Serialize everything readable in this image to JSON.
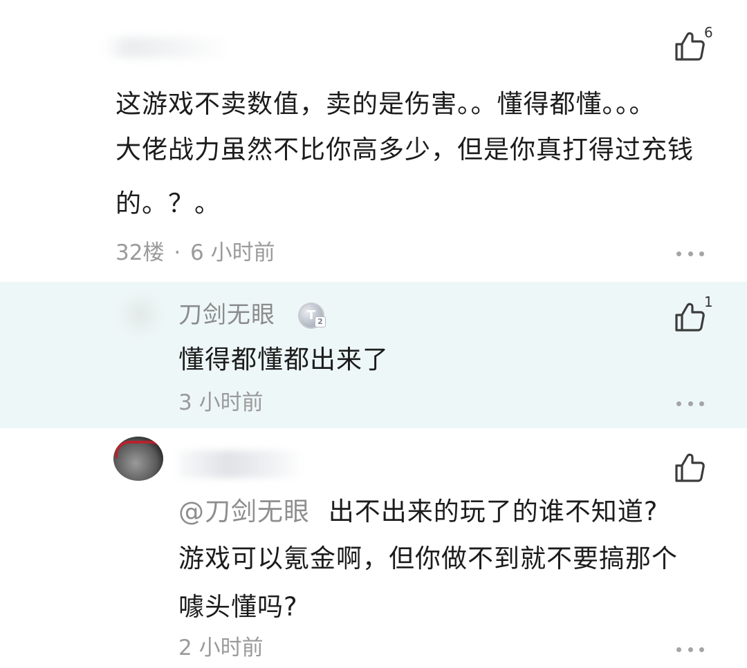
{
  "comments": [
    {
      "text_lines": [
        "这游戏不卖数值，卖的是伤害。。懂得都懂。。。",
        "大佬战力虽然不比你高多少，但是你真打得过充钱",
        "的。？。"
      ],
      "floor": "32楼",
      "separator": "·",
      "time": "6 小时前",
      "likes": "6"
    },
    {
      "username": "刀剑无眼",
      "level_badge": "T",
      "level_sub": "2",
      "text": "懂得都懂都出来了",
      "time": "3 小时前",
      "likes": "1"
    },
    {
      "mention": "@刀剑无眼",
      "text_lines": [
        "出不出来的玩了的谁不知道?",
        "游戏可以氪金啊，但你做不到就不要搞那个",
        "噱头懂吗?"
      ],
      "time": "2 小时前"
    }
  ],
  "icons": {
    "like": "thumbs-up-icon",
    "more": "more-dots-icon"
  },
  "colors": {
    "reply_highlight": "#eef7f7",
    "meta_text": "#9a9a9a",
    "username": "#8b8b8b"
  }
}
